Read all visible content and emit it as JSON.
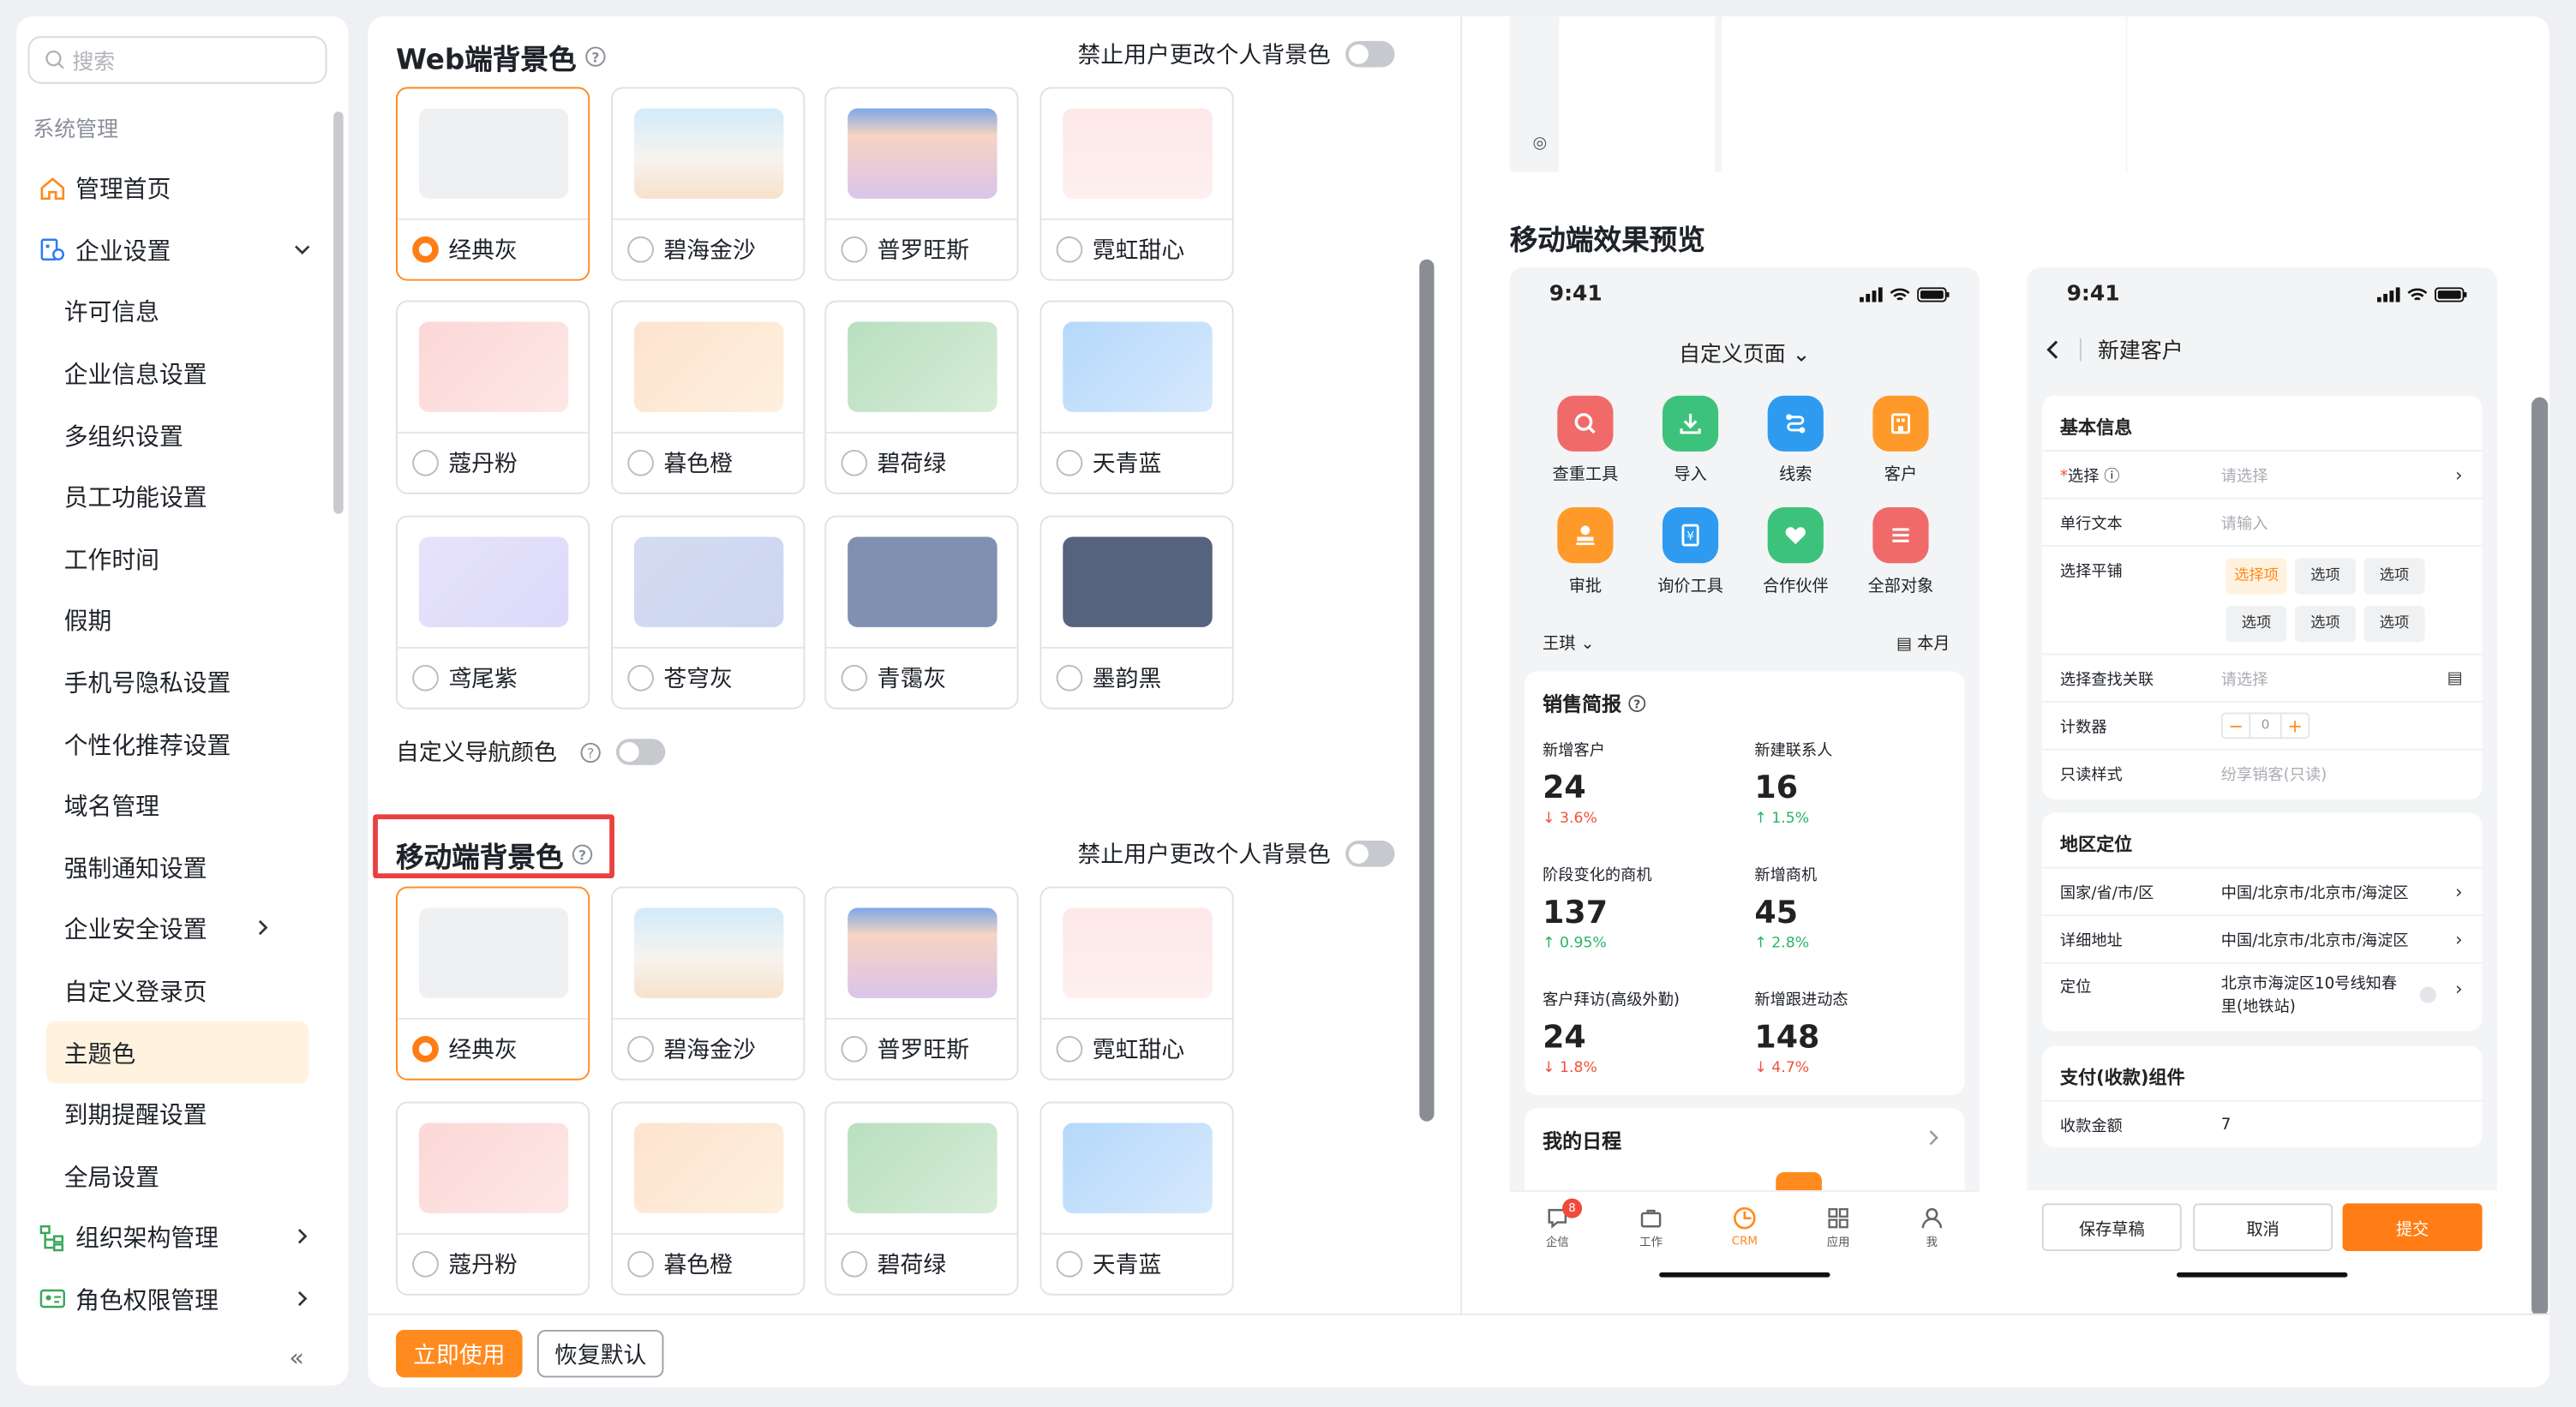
{
  "sidebar": {
    "search_placeholder": "搜索",
    "section": "系统管理",
    "items": [
      {
        "label": "管理首页"
      },
      {
        "label": "企业设置"
      },
      {
        "label": "许可信息"
      },
      {
        "label": "企业信息设置"
      },
      {
        "label": "多组织设置"
      },
      {
        "label": "员工功能设置"
      },
      {
        "label": "工作时间"
      },
      {
        "label": "假期"
      },
      {
        "label": "手机号隐私设置"
      },
      {
        "label": "个性化推荐设置"
      },
      {
        "label": "域名管理"
      },
      {
        "label": "强制通知设置"
      },
      {
        "label": "企业安全设置"
      },
      {
        "label": "自定义登录页"
      },
      {
        "label": "主题色"
      },
      {
        "label": "到期提醒设置"
      },
      {
        "label": "全局设置"
      },
      {
        "label": "组织架构管理"
      },
      {
        "label": "角色权限管理"
      }
    ],
    "active": "主题色",
    "collapse_icon": "«"
  },
  "web": {
    "title": "Web端背景色",
    "lock_label": "禁止用户更改个人背景色",
    "themes": [
      {
        "name": "经典灰"
      },
      {
        "name": "碧海金沙"
      },
      {
        "name": "普罗旺斯"
      },
      {
        "name": "霓虹甜心"
      },
      {
        "name": "蔻丹粉"
      },
      {
        "name": "暮色橙"
      },
      {
        "name": "碧荷绿"
      },
      {
        "name": "天青蓝"
      },
      {
        "name": "鸢尾紫"
      },
      {
        "name": "苍穹灰"
      },
      {
        "name": "青霭灰"
      },
      {
        "name": "墨韵黑"
      }
    ],
    "selected": "经典灰",
    "nav_color_label": "自定义导航颜色"
  },
  "mobile": {
    "title": "移动端背景色",
    "lock_label": "禁止用户更改个人背景色",
    "themes": [
      {
        "name": "经典灰"
      },
      {
        "name": "碧海金沙"
      },
      {
        "name": "普罗旺斯"
      },
      {
        "name": "霓虹甜心"
      },
      {
        "name": "蔻丹粉"
      },
      {
        "name": "暮色橙"
      },
      {
        "name": "碧荷绿"
      },
      {
        "name": "天青蓝"
      }
    ],
    "selected": "经典灰"
  },
  "footer": {
    "apply": "立即使用",
    "reset": "恢复默认"
  },
  "preview": {
    "title": "移动端效果预览",
    "phone1": {
      "time": "9:41",
      "page_title": "自定义页面",
      "apps": [
        {
          "label": "查重工具",
          "color": "#f06a6a"
        },
        {
          "label": "导入",
          "color": "#3dc27b"
        },
        {
          "label": "线索",
          "color": "#2e9bf0"
        },
        {
          "label": "客户",
          "color": "#ff9a2a"
        },
        {
          "label": "审批",
          "color": "#ff9a2a"
        },
        {
          "label": "询价工具",
          "color": "#2e9bf0"
        },
        {
          "label": "合作伙伴",
          "color": "#3dc27b"
        },
        {
          "label": "全部对象",
          "color": "#f06a6a"
        }
      ],
      "user": "王琪",
      "period": "本月",
      "sales_title": "销售简报",
      "metrics": [
        {
          "label": "新增客户",
          "value": "24",
          "delta": "3.6%",
          "dir": "down"
        },
        {
          "label": "新建联系人",
          "value": "16",
          "delta": "1.5%",
          "dir": "up"
        },
        {
          "label": "阶段变化的商机",
          "value": "137",
          "delta": "0.95%",
          "dir": "up"
        },
        {
          "label": "新增商机",
          "value": "45",
          "delta": "2.8%",
          "dir": "up"
        },
        {
          "label": "客户拜访(高级外勤)",
          "value": "24",
          "delta": "1.8%",
          "dir": "down"
        },
        {
          "label": "新增跟进动态",
          "value": "148",
          "delta": "4.7%",
          "dir": "down"
        }
      ],
      "schedule_title": "我的日程",
      "tabs": [
        {
          "label": "企信",
          "badge": "8"
        },
        {
          "label": "工作"
        },
        {
          "label": "CRM"
        },
        {
          "label": "应用"
        },
        {
          "label": "我"
        }
      ]
    },
    "phone2": {
      "time": "9:41",
      "nav_title": "新建客户",
      "basic_title": "基本信息",
      "fields": {
        "select": {
          "label": "选择",
          "placeholder": "请选择"
        },
        "text": {
          "label": "单行文本",
          "placeholder": "请输入"
        },
        "tile": {
          "label": "选择平铺",
          "chips": [
            "选择项",
            "选项",
            "选项",
            "选项",
            "选项",
            "选项"
          ]
        },
        "lookup": {
          "label": "选择查找关联",
          "placeholder": "请选择"
        },
        "counter": {
          "label": "计数器",
          "value": "0"
        },
        "readonly": {
          "label": "只读样式",
          "value": "纷享销客(只读)"
        }
      },
      "region_title": "地区定位",
      "region": [
        {
          "label": "国家/省/市/区",
          "value": "中国/北京市/北京市/海淀区"
        },
        {
          "label": "详细地址",
          "value": "中国/北京市/北京市/海淀区"
        },
        {
          "label": "定位",
          "value": "北京市海淀区10号线知春里(地铁站)"
        }
      ],
      "pay_title": "支付(收款)组件",
      "pay": {
        "label": "收款金额",
        "value": "7"
      },
      "buttons": {
        "draft": "保存草稿",
        "cancel": "取消",
        "submit": "提交"
      }
    }
  }
}
